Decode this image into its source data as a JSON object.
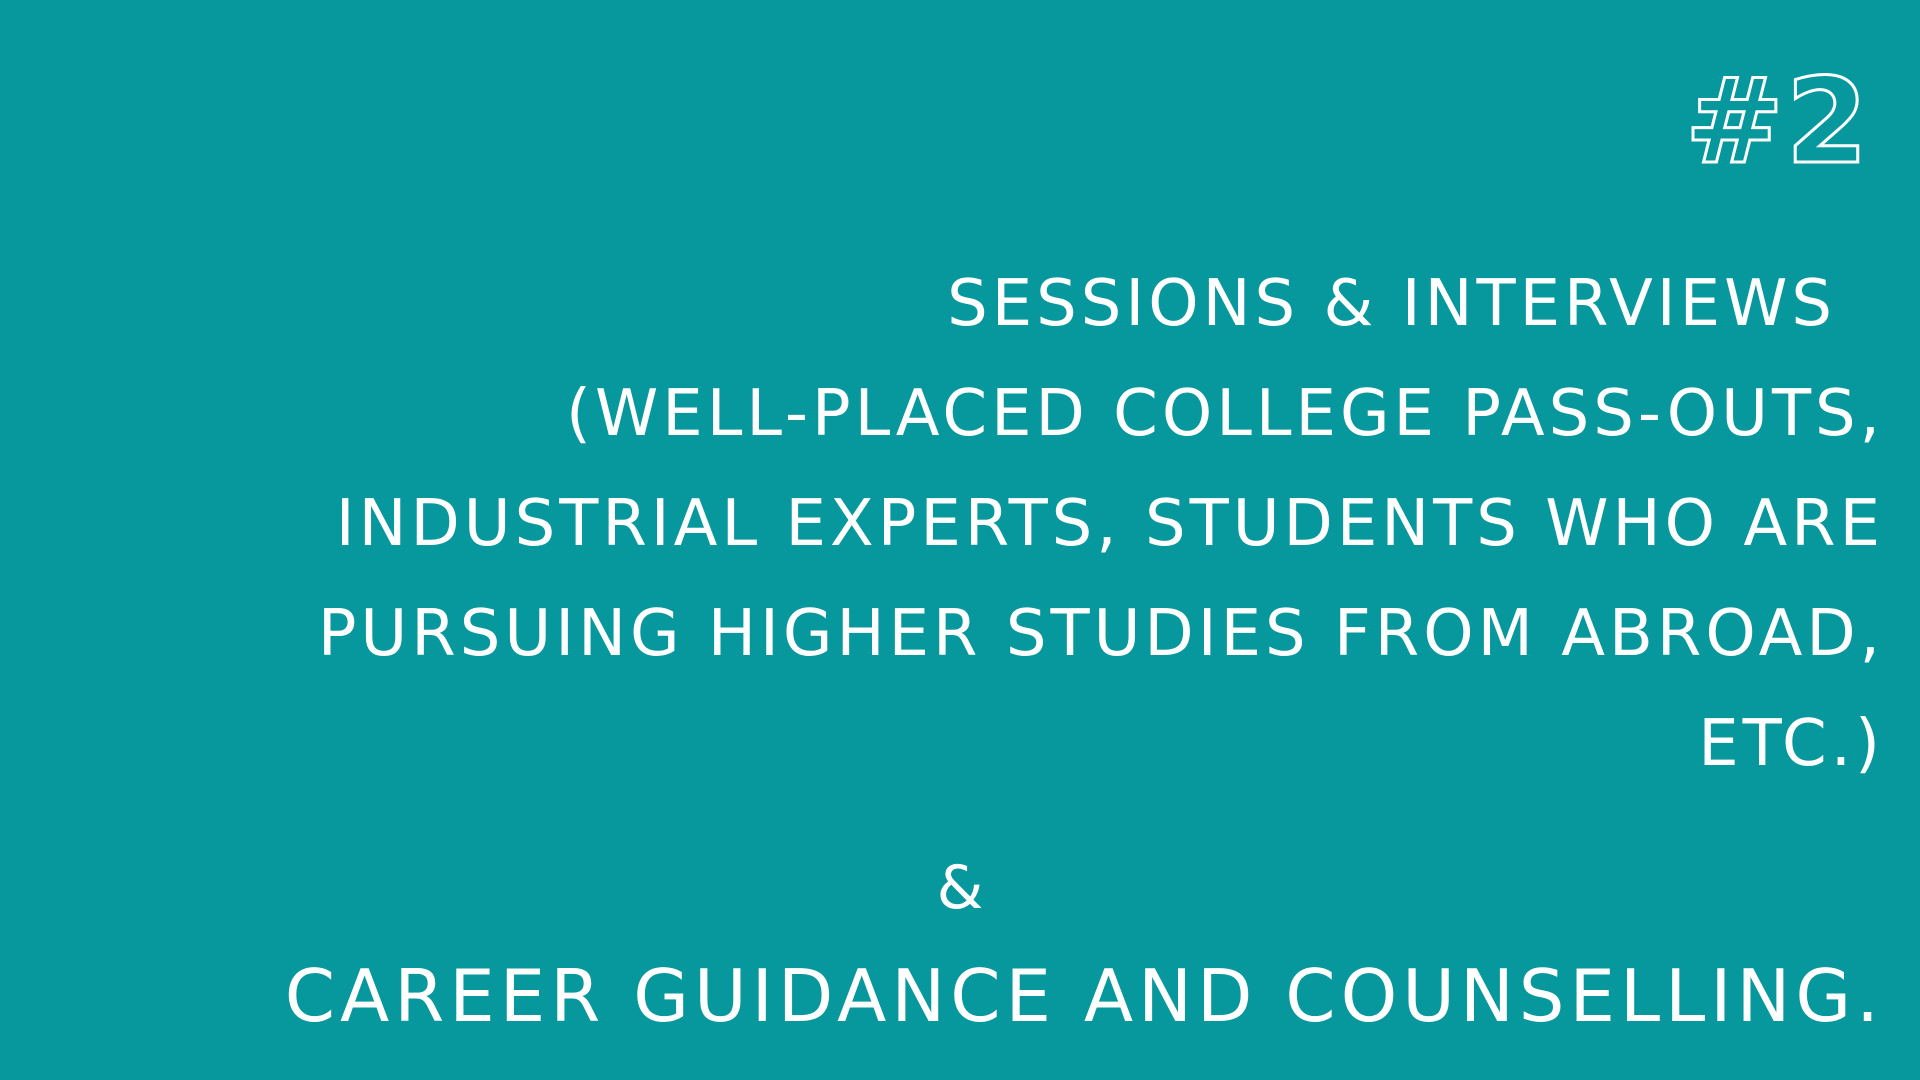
{
  "badge": "#2",
  "heading": "SESSIONS & INTERVIEWS",
  "details": [
    "(WELL-PLACED COLLEGE PASS-OUTS,",
    "INDUSTRIAL EXPERTS, STUDENTS WHO ARE",
    "PURSUING HIGHER STUDIES FROM ABROAD,",
    "ETC.)"
  ],
  "connector": "&",
  "closing": "CAREER GUIDANCE AND COUNSELLING.",
  "colors": {
    "background": "#06989d",
    "text": "#ffffff"
  }
}
